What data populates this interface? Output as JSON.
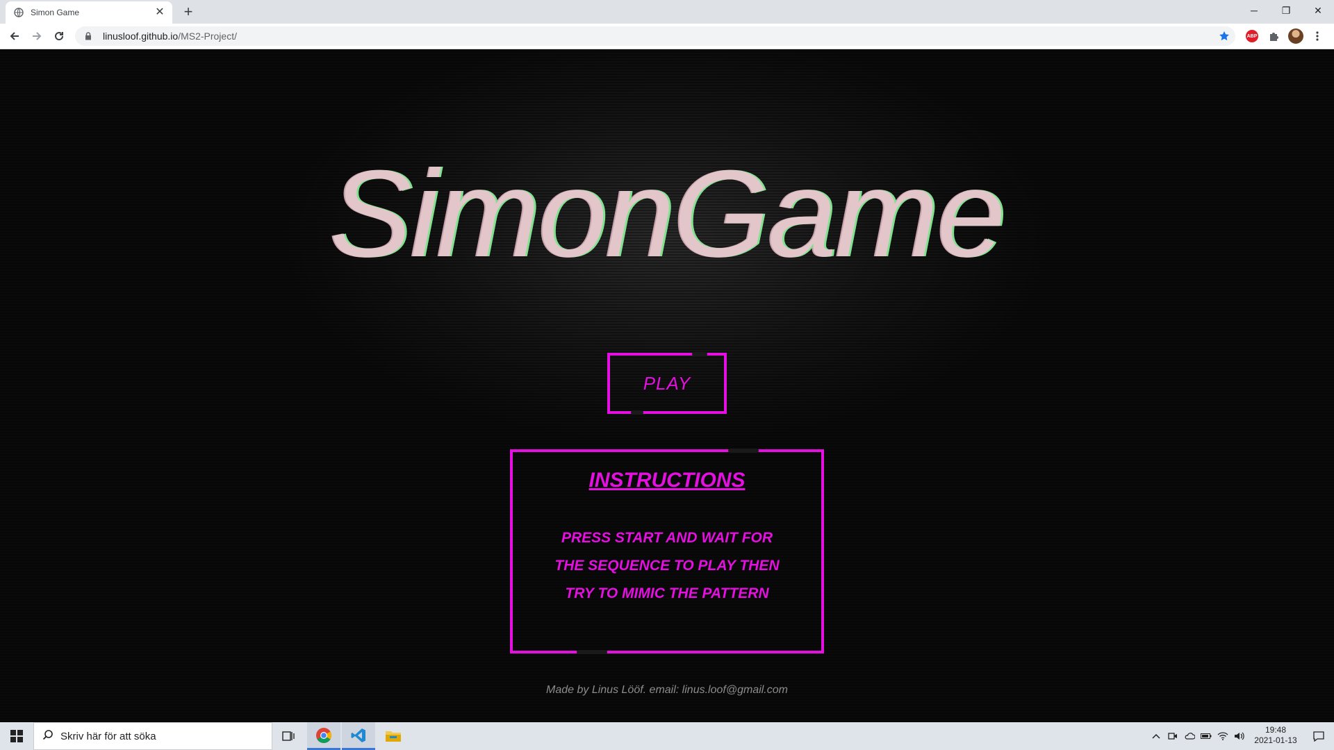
{
  "browser": {
    "tab_title": "Simon Game",
    "tab_close": "✕",
    "new_tab": "+",
    "url_host": "linusloof.github.io",
    "url_path": "/MS2-Project/",
    "window_controls": {
      "minimize": "─",
      "restore": "❐",
      "close": "✕"
    }
  },
  "page": {
    "logo": "SimonGame",
    "play_label": "PLAY",
    "instructions_title": "INSTRUCTIONS",
    "instructions_lines": [
      "PRESS START AND WAIT FOR",
      "THE SEQUENCE TO PLAY THEN",
      "TRY TO MIMIC THE PATTERN"
    ],
    "footer": "Made by Linus Lööf. email: linus.loof@gmail.com",
    "accent_color": "#e40fe0"
  },
  "taskbar": {
    "search_placeholder": "Skriv här för att söka",
    "time": "19:48",
    "date": "2021-01-13",
    "pinned": [
      "task-view-icon",
      "chrome-icon",
      "vscode-icon",
      "file-explorer-icon"
    ]
  }
}
